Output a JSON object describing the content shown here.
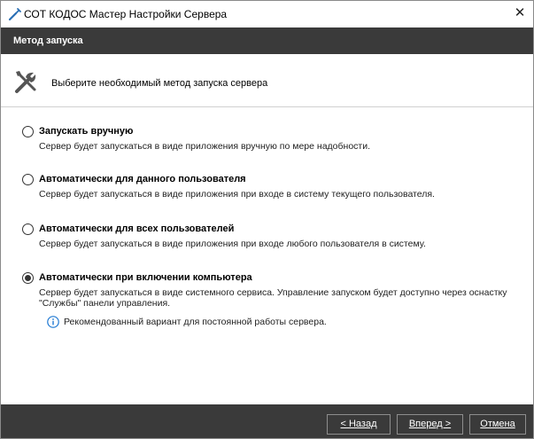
{
  "window": {
    "title": "СОТ КОДОС Мастер Настройки Сервера",
    "close_glyph": "✕"
  },
  "header": {
    "title": "Метод запуска"
  },
  "info": {
    "icon": "tools-icon",
    "text": "Выберите необходимый метод запуска сервера"
  },
  "options": [
    {
      "label": "Запускать вручную",
      "description": [
        "Сервер будет запускаться в виде приложения вручную по мере надобности."
      ],
      "checked": false
    },
    {
      "label": "Автоматически для данного пользователя",
      "description": [
        "Сервер будет запускаться в виде приложения при входе  в систему текущего пользователя."
      ],
      "checked": false
    },
    {
      "label": "Автоматически для всех пользователей",
      "description": [
        "Сервер будет запускаться в виде приложения при входе любого пользователя в систему."
      ],
      "checked": false
    },
    {
      "label": "Автоматически при включении компьютера",
      "description": [
        "Сервер будет запускаться в виде системного сервиса. Управление запуском будет доступно через оснастку",
        "\"Службы\" панели управления."
      ],
      "checked": true
    }
  ],
  "recommendation": {
    "icon": "info-icon",
    "text": "Рекомендованный вариант для постоянной работы сервера."
  },
  "buttons": {
    "back": "< Назад",
    "next": "Вперед >",
    "cancel": "Отмена"
  },
  "colors": {
    "dark_bar": "#3a3a3a",
    "info_blue": "#1e78d2"
  }
}
